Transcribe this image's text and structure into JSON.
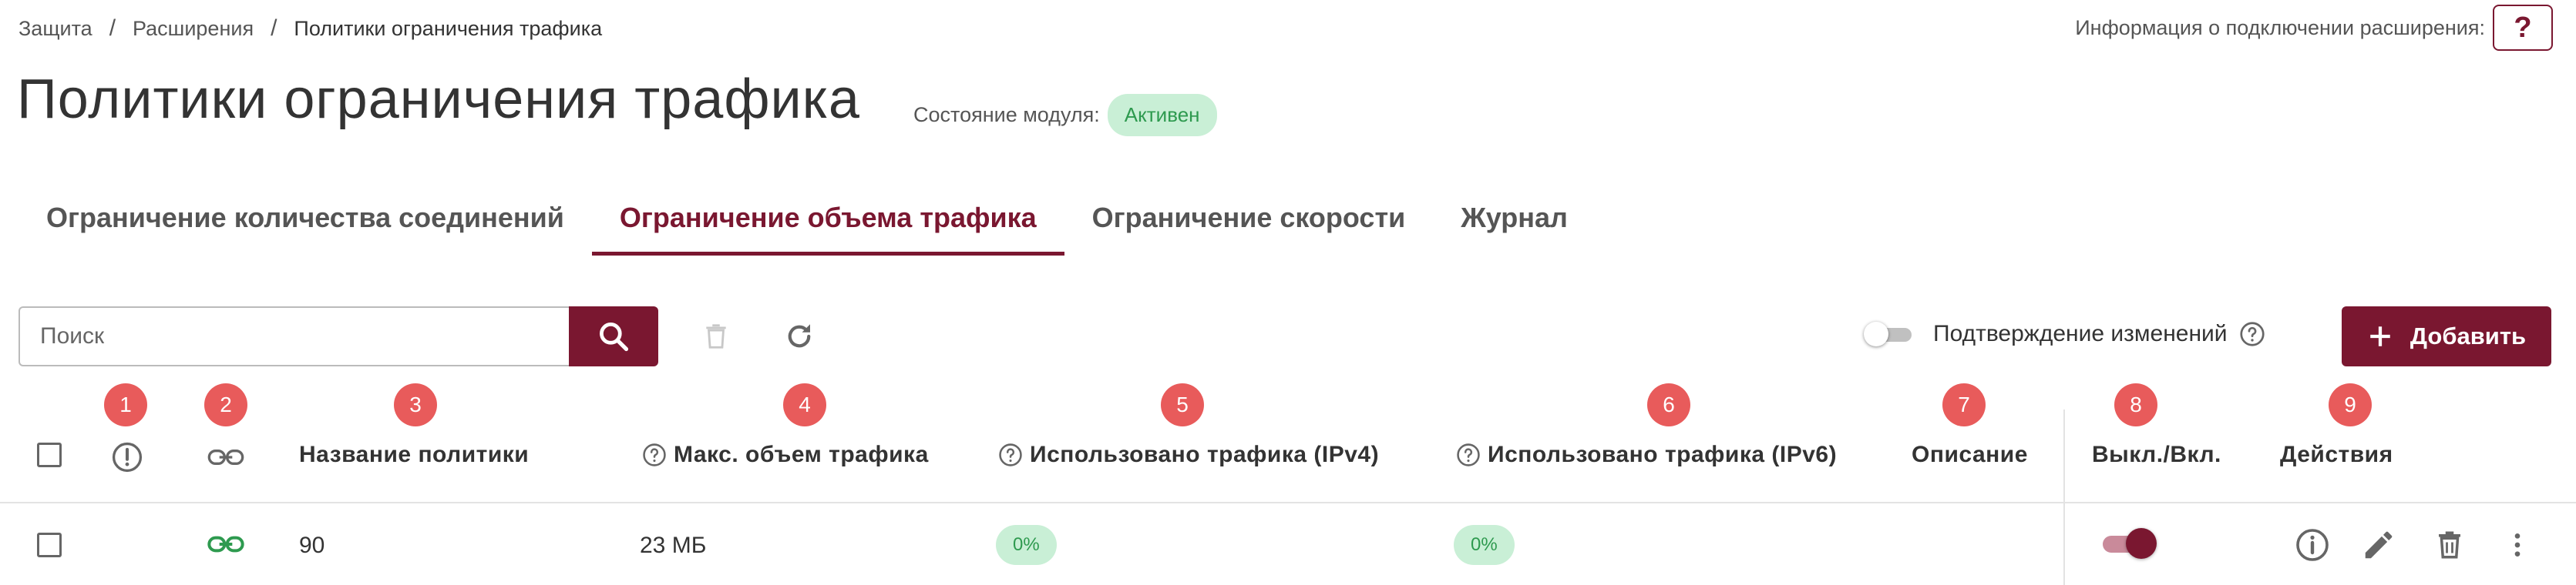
{
  "breadcrumb": {
    "items": [
      {
        "label": "Защита"
      },
      {
        "label": "Расширения"
      },
      {
        "label": "Политики ограничения трафика"
      }
    ],
    "separator": "/"
  },
  "connection_info": {
    "label": "Информация о подключении расширения:",
    "help_glyph": "?"
  },
  "page": {
    "title": "Политики ограничения трафика",
    "module_state_label": "Состояние модуля:",
    "module_state_value": "Активен"
  },
  "tabs": [
    {
      "label": "Ограничение количества соединений",
      "active": false
    },
    {
      "label": "Ограничение объема трафика",
      "active": true
    },
    {
      "label": "Ограничение скорости",
      "active": false
    },
    {
      "label": "Журнал",
      "active": false
    }
  ],
  "toolbar": {
    "search_placeholder": "Поиск",
    "confirm_changes_label": "Подтверждение изменений",
    "confirm_changes_enabled": false,
    "add_label": "Добавить",
    "icons": [
      "search-icon",
      "trash-icon",
      "refresh-icon",
      "plus-icon"
    ]
  },
  "table": {
    "markers": [
      "1",
      "2",
      "3",
      "4",
      "5",
      "6",
      "7",
      "8",
      "9"
    ],
    "headers": {
      "name": "Название политики",
      "max_volume": "Макс. объем трафика",
      "used_ipv4": "Использовано трафика (IPv4)",
      "used_ipv6": "Использовано трафика (IPv6)",
      "description": "Описание",
      "toggle": "Выкл./Вкл.",
      "actions": "Действия"
    },
    "rows": [
      {
        "name": "90",
        "max_volume": "23 МБ",
        "used_ipv4": "0%",
        "used_ipv6": "0%",
        "description": "",
        "enabled": true,
        "linked": true
      }
    ]
  },
  "colors": {
    "accent": "#7a1730",
    "accent_light": "#c98a9a",
    "success_bg": "#c9efd6",
    "success_text": "#2e9a4f",
    "marker": "#e85b5b",
    "link_green": "#2e9a4f"
  }
}
